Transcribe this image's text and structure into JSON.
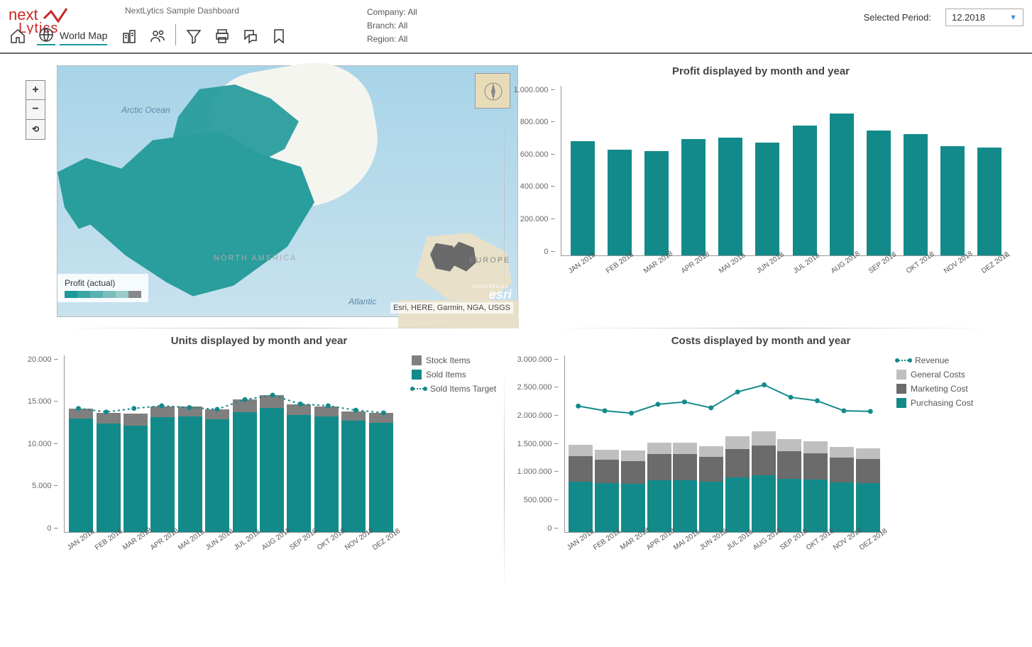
{
  "header": {
    "app_name": "NextLytics Sample Dashboard",
    "company": "Company: All",
    "branch": "Branch: All",
    "region": "Region: All",
    "period_label": "Selected Period:",
    "period_value": "12.2018",
    "active_tab": "World Map"
  },
  "map": {
    "legend_title": "Profit (actual)",
    "ocean_arctic": "Arctic Ocean",
    "ocean_atlantic": "Atlantic",
    "continent_na": "NORTH AMERICA",
    "continent_eu": "EUROPE",
    "attribution": "Esri, HERE, Garmin, NGA, USGS",
    "esri": "esri",
    "powered": "POWERED BY",
    "gradient_colors": [
      "#1a9999",
      "#3aa5a5",
      "#5ab1b1",
      "#7abdbd",
      "#9ac9c9",
      "#888888"
    ]
  },
  "chart_data": [
    {
      "id": "profit",
      "type": "bar",
      "title": "Profit displayed by month and year",
      "categories": [
        "JAN 2018",
        "FEB 2018",
        "MAR 2018",
        "APR 2018",
        "MAI 2018",
        "JUN 2018",
        "JUL 2018",
        "AUG 2018",
        "SEP 2018",
        "OKT 2018",
        "NOV 2018",
        "DEZ 2018"
      ],
      "series": [
        {
          "name": "Profit",
          "color": "#138a8a",
          "values": [
            670000,
            620000,
            610000,
            680000,
            690000,
            660000,
            760000,
            830000,
            730000,
            710000,
            640000,
            630000
          ]
        }
      ],
      "yticks": [
        0,
        200000,
        400000,
        600000,
        800000,
        1000000
      ],
      "yticklabels": [
        "0",
        "200.000",
        "400.000",
        "600.000",
        "800.000",
        "1.000.000"
      ],
      "ylim": [
        0,
        1000000
      ]
    },
    {
      "id": "units",
      "type": "bar-line",
      "title": "Units displayed by month and year",
      "categories": [
        "JAN 2018",
        "FEB 2018",
        "MAR 2018",
        "APR 2018",
        "MAI 2018",
        "JUN 2018",
        "JUL 2018",
        "AUG 2018",
        "SEP 2018",
        "OKT 2018",
        "NOV 2018",
        "DEZ 2018"
      ],
      "series": [
        {
          "name": "Sold Items",
          "type": "bar",
          "color": "#138a8a",
          "values": [
            12800,
            12200,
            12000,
            12900,
            13000,
            12700,
            13500,
            14000,
            13200,
            13000,
            12500,
            12300
          ]
        },
        {
          "name": "Stock Items",
          "type": "bar",
          "color": "#7f7f7f",
          "values": [
            1100,
            1200,
            1300,
            1200,
            1100,
            1100,
            1400,
            1400,
            1200,
            1100,
            1100,
            1100
          ]
        },
        {
          "name": "Sold Items Target",
          "type": "line",
          "color": "#138a8a",
          "values": [
            14000,
            13600,
            14000,
            14300,
            14100,
            13900,
            15000,
            15500,
            14500,
            14300,
            13800,
            13500
          ]
        }
      ],
      "legend_order": [
        "Stock Items",
        "Sold Items",
        "Sold Items Target"
      ],
      "yticks": [
        0,
        5000,
        10000,
        15000,
        20000
      ],
      "yticklabels": [
        "0",
        "5.000",
        "10.000",
        "15.000",
        "20.000"
      ],
      "ylim": [
        0,
        20000
      ]
    },
    {
      "id": "costs",
      "type": "bar-line",
      "title": "Costs displayed by month and year",
      "categories": [
        "JAN 2018",
        "FEB 2018",
        "MAR 2018",
        "APR 2018",
        "MAI 2018",
        "JUN 2018",
        "JUL 2018",
        "AUG 2018",
        "SEP 2018",
        "OKT 2018",
        "NOV 2018",
        "DEZ 2018"
      ],
      "series": [
        {
          "name": "Purchasing Cost",
          "type": "bar",
          "color": "#138a8a",
          "values": [
            850000,
            820000,
            810000,
            870000,
            870000,
            850000,
            920000,
            960000,
            900000,
            880000,
            830000,
            820000
          ]
        },
        {
          "name": "Marketing Cost",
          "type": "bar",
          "color": "#6b6b6b",
          "values": [
            430000,
            400000,
            390000,
            440000,
            440000,
            420000,
            480000,
            500000,
            460000,
            450000,
            420000,
            410000
          ]
        },
        {
          "name": "General Costs",
          "type": "bar",
          "color": "#bfbfbf",
          "values": [
            190000,
            170000,
            170000,
            200000,
            200000,
            180000,
            220000,
            240000,
            210000,
            200000,
            180000,
            180000
          ]
        },
        {
          "name": "Revenue",
          "type": "line",
          "color": "#138a8a",
          "values": [
            2140000,
            2060000,
            2020000,
            2170000,
            2210000,
            2110000,
            2380000,
            2500000,
            2290000,
            2230000,
            2060000,
            2050000
          ]
        }
      ],
      "legend_order": [
        "Revenue",
        "General Costs",
        "Marketing Cost",
        "Purchasing Cost"
      ],
      "yticks": [
        0,
        500000,
        1000000,
        1500000,
        2000000,
        2500000,
        3000000
      ],
      "yticklabels": [
        "0",
        "500.000",
        "1.000.000",
        "1.500.000",
        "2.000.000",
        "2.500.000",
        "3.000.000"
      ],
      "ylim": [
        0,
        3000000
      ]
    }
  ]
}
